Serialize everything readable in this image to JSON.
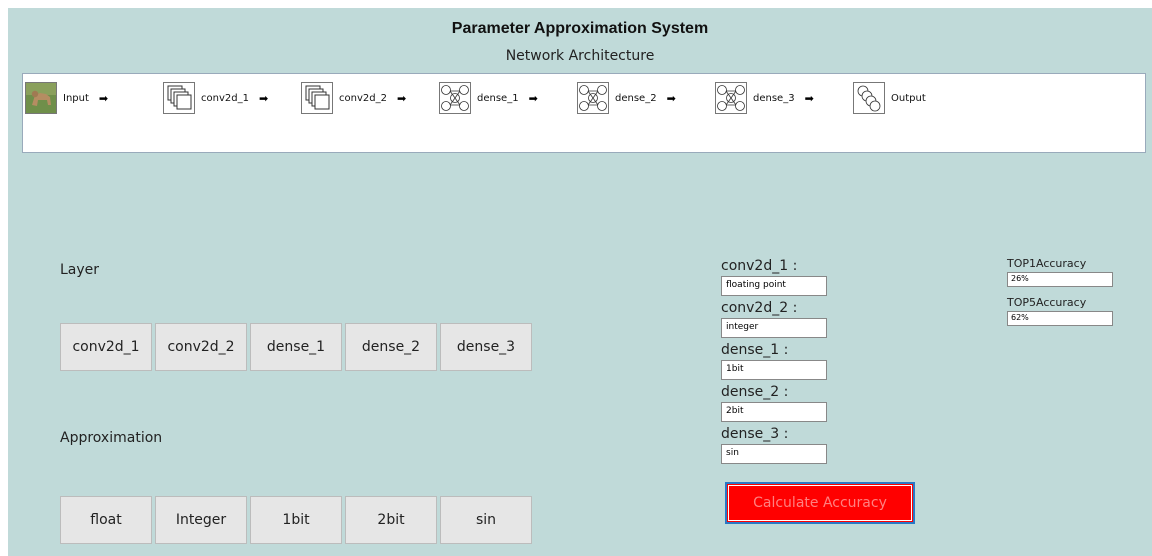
{
  "header": {
    "title": "Parameter Approximation System",
    "subtitle": "Network Architecture"
  },
  "architecture": {
    "nodes": [
      {
        "label": "Input",
        "icon": "dog-image-icon",
        "arrow": "➡"
      },
      {
        "label": "conv2d_1",
        "icon": "stacked-layers-icon",
        "arrow": "➡"
      },
      {
        "label": "conv2d_2",
        "icon": "stacked-layers-icon",
        "arrow": "➡"
      },
      {
        "label": "dense_1",
        "icon": "neural-net-icon",
        "arrow": "➡"
      },
      {
        "label": "dense_2",
        "icon": "neural-net-icon",
        "arrow": "➡"
      },
      {
        "label": "dense_3",
        "icon": "neural-net-icon",
        "arrow": "➡"
      },
      {
        "label": "Output",
        "icon": "output-circles-icon",
        "arrow": ""
      }
    ]
  },
  "layer_section": {
    "label": "Layer",
    "buttons": [
      "conv2d_1",
      "conv2d_2",
      "dense_1",
      "dense_2",
      "dense_3"
    ]
  },
  "approx_section": {
    "label": "Approximation",
    "buttons": [
      "float",
      "Integer",
      "1bit",
      "2bit",
      "sin"
    ]
  },
  "settings": [
    {
      "label": "conv2d_1 :",
      "value": "floating point"
    },
    {
      "label": "conv2d_2 :",
      "value": "integer"
    },
    {
      "label": "dense_1 :",
      "value": "1bit"
    },
    {
      "label": "dense_2 :",
      "value": "2bit"
    },
    {
      "label": "dense_3 :",
      "value": "sin"
    }
  ],
  "accuracy": {
    "top1_label": "TOP1Accuracy",
    "top1_value": "26%",
    "top5_label": "TOP5Accuracy",
    "top5_value": "62%"
  },
  "calculate_label": "Calculate Accuracy",
  "colors": {
    "background": "#c0dad9",
    "calculate_button": "#ff0000",
    "calculate_text": "#ff8080"
  }
}
